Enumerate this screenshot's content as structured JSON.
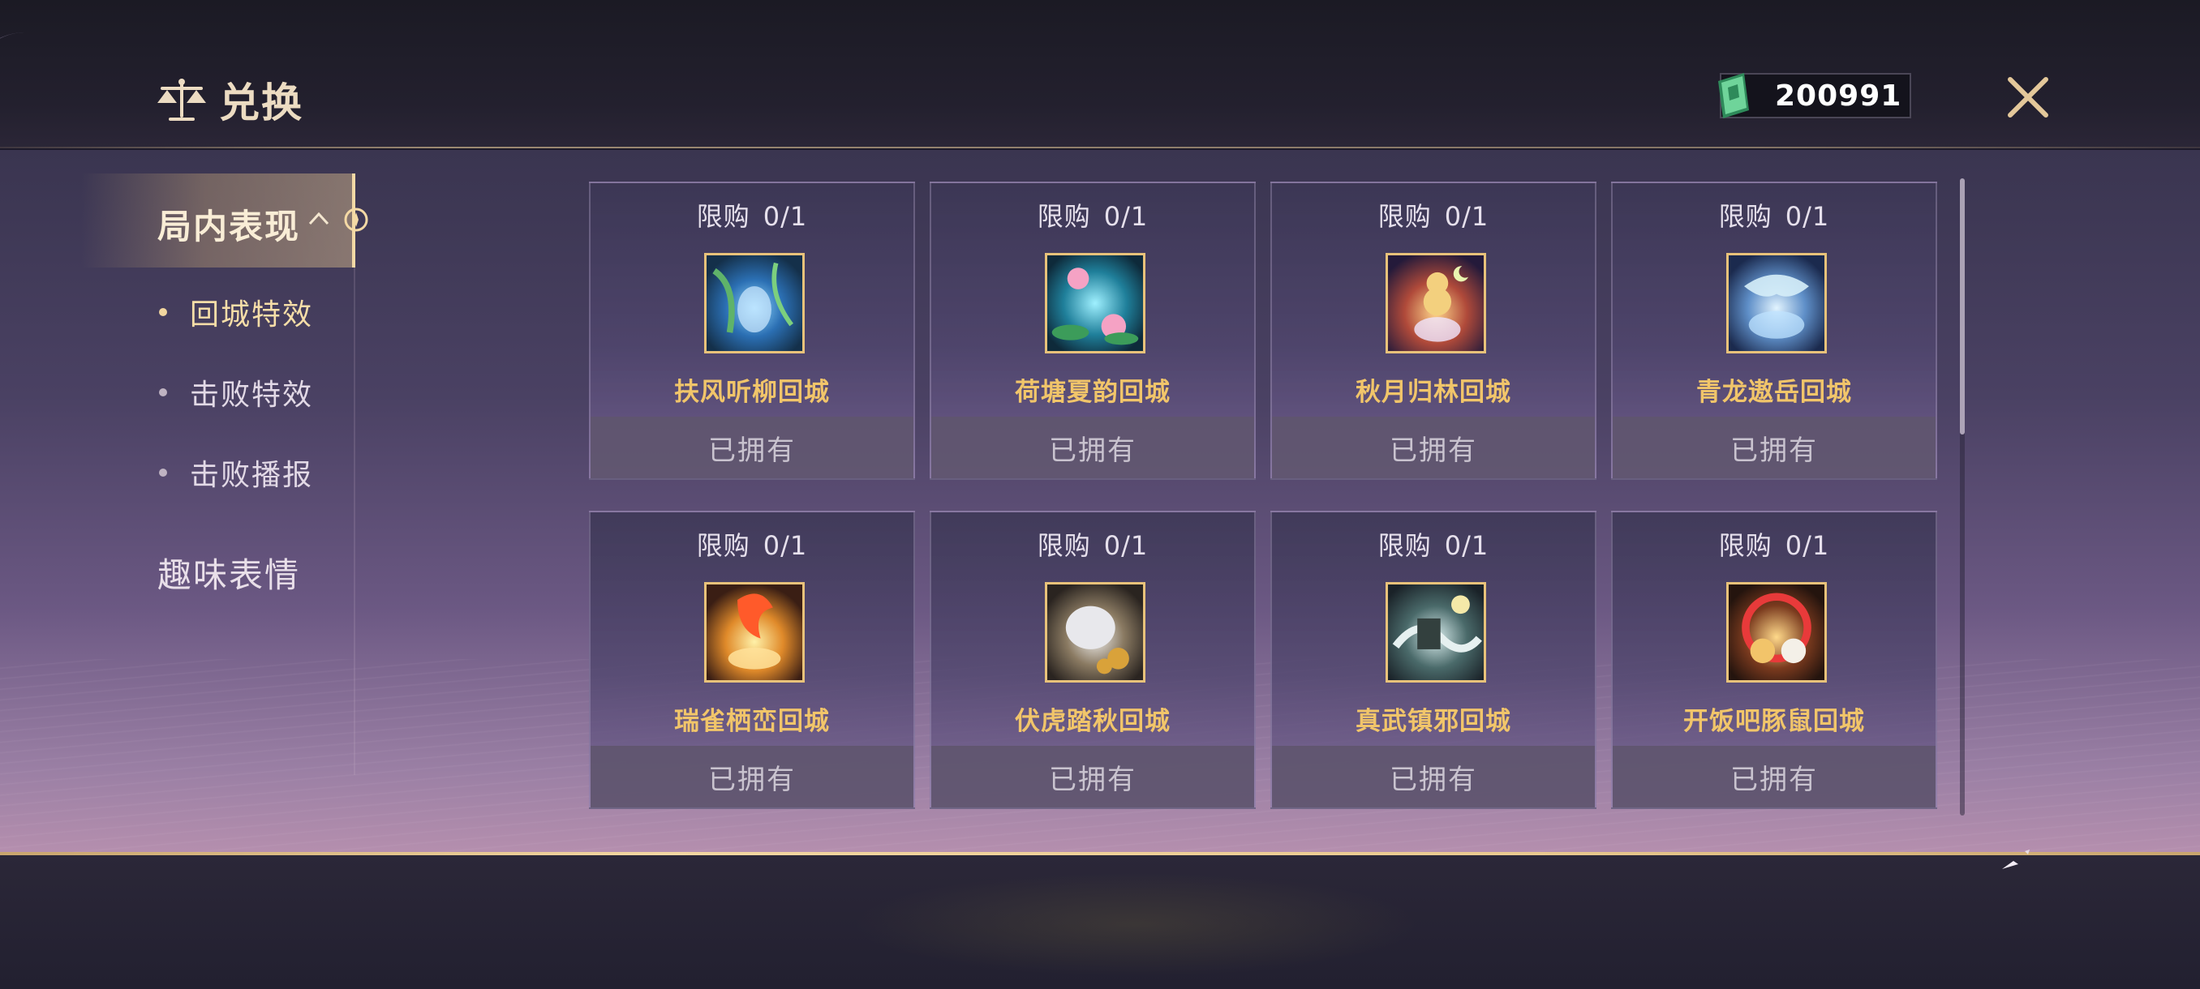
{
  "header": {
    "title": "兑换",
    "title_icon": "scales-icon",
    "currency_icon": "ticket-icon",
    "currency_value": "200991",
    "close_icon": "close-icon"
  },
  "sidebar": {
    "active_category": "局内表现",
    "active_chevron_icon": "chevron-up-icon",
    "sub_items": [
      {
        "label": "回城特效",
        "selected": true
      },
      {
        "label": "击败特效",
        "selected": false
      },
      {
        "label": "击败播报",
        "selected": false
      }
    ],
    "other_categories": [
      {
        "label": "趣味表情"
      }
    ]
  },
  "items": [
    {
      "limit_label": "限购",
      "limit_value": "0/1",
      "name": "扶风听柳回城",
      "status": "已拥有"
    },
    {
      "limit_label": "限购",
      "limit_value": "0/1",
      "name": "荷塘夏韵回城",
      "status": "已拥有"
    },
    {
      "limit_label": "限购",
      "limit_value": "0/1",
      "name": "秋月归林回城",
      "status": "已拥有"
    },
    {
      "limit_label": "限购",
      "limit_value": "0/1",
      "name": "青龙遨岳回城",
      "status": "已拥有"
    },
    {
      "limit_label": "限购",
      "limit_value": "0/1",
      "name": "瑞雀栖峦回城",
      "status": "已拥有"
    },
    {
      "limit_label": "限购",
      "limit_value": "0/1",
      "name": "伏虎踏秋回城",
      "status": "已拥有"
    },
    {
      "limit_label": "限购",
      "limit_value": "0/1",
      "name": "真武镇邪回城",
      "status": "已拥有"
    },
    {
      "limit_label": "限购",
      "limit_value": "0/1",
      "name": "开饭吧豚鼠回城",
      "status": "已拥有"
    }
  ],
  "colors": {
    "accent_gold": "#f1c56a",
    "title_text": "#ecdcc2",
    "frame_gold": "#e8c27a",
    "owned_text": "#c9c3cf"
  }
}
